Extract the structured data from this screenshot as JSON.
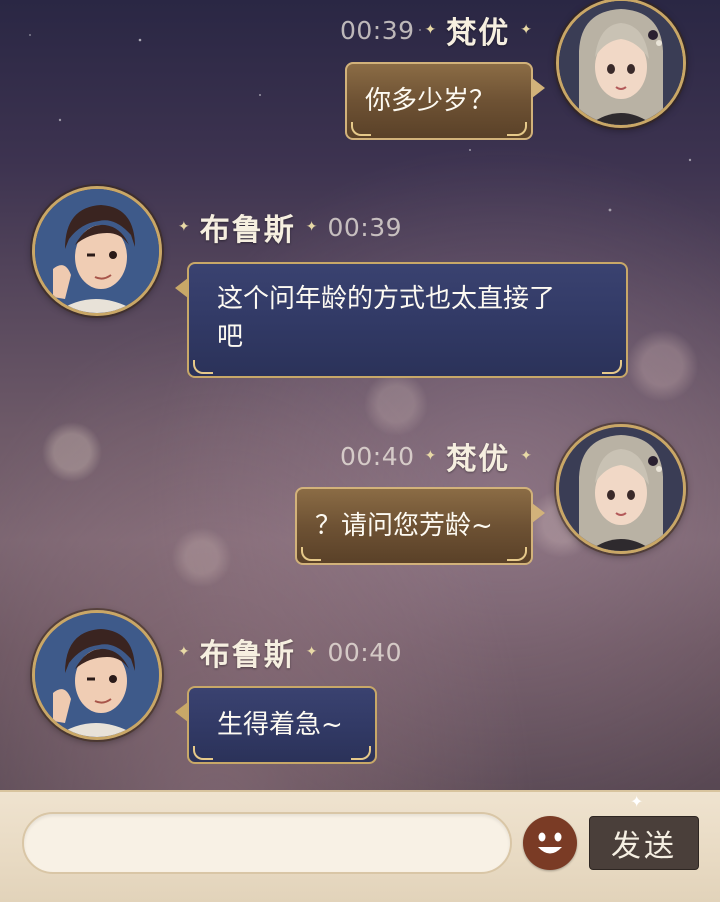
{
  "messages": [
    {
      "side": "right",
      "time": "00:39",
      "name": "梵优",
      "text": "你多少岁？"
    },
    {
      "side": "left",
      "name": "布鲁斯",
      "time": "00:39",
      "text_line1": "这个问年龄的方式也太直接了",
      "text_line2": "吧"
    },
    {
      "side": "right",
      "time": "00:40",
      "name": "梵优",
      "text": "？请问您芳龄~"
    },
    {
      "side": "left",
      "name": "布鲁斯",
      "time": "00:40",
      "text": "生得着急~"
    }
  ],
  "input": {
    "value": "",
    "placeholder": ""
  },
  "send_button": {
    "label": "发送"
  },
  "icons": {
    "emoji": "smiley-face-icon",
    "separator": "sparkle-star-icon"
  },
  "colors": {
    "bubble_self": "#6e5234",
    "bubble_other": "#323a66",
    "trim_gold": "#d2b27a",
    "send_button": "#4a3f3a",
    "emoji_button": "#7a3b25"
  }
}
